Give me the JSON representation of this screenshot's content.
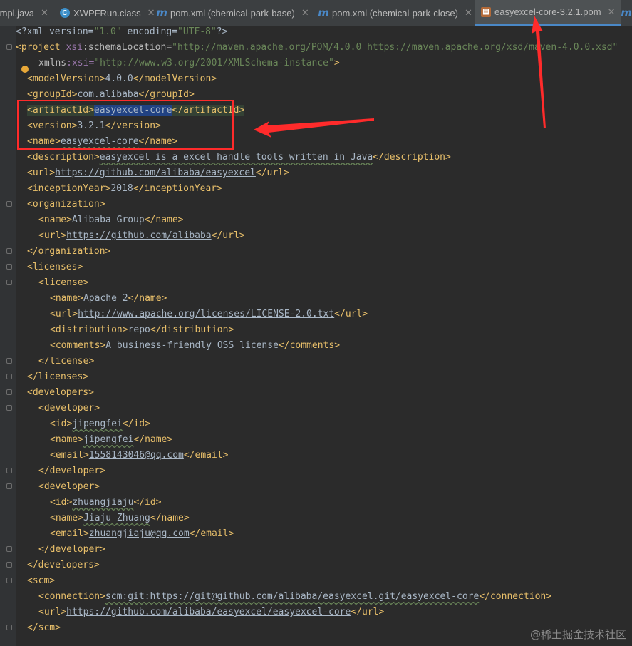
{
  "tabs": [
    {
      "label": "Impl.java",
      "icon": "java-file-icon",
      "active": false
    },
    {
      "label": "XWPFRun.class",
      "icon": "class-file-icon",
      "active": false
    },
    {
      "label": "pom.xml (chemical-park-base)",
      "icon": "maven-icon",
      "active": false
    },
    {
      "label": "pom.xml (chemical-park-close)",
      "icon": "maven-icon",
      "active": false
    },
    {
      "label": "easyexcel-core-3.2.1.pom",
      "icon": "pom-file-icon",
      "active": true
    }
  ],
  "code": {
    "l1": {
      "a": "<?xml version=",
      "b": "\"1.0\"",
      "c": " encoding=",
      "d": "\"UTF-8\"",
      "e": "?>"
    },
    "l2": {
      "a": "<project ",
      "b": "xsi",
      "c": ":schemaLocation=",
      "d": "\"http://maven.apache.org/POM/4.0.0 https://maven.apache.org/xsd/maven-4.0.0.xsd\""
    },
    "l3": {
      "a": "xmlns",
      "b": ":xsi=",
      "c": "\"http://www.w3.org/2001/XMLSchema-instance\"",
      "d": ">"
    },
    "l4": {
      "a": "<modelVersion>",
      "b": "4.0.0",
      "c": "</modelVersion>"
    },
    "l5": {
      "a": "<groupId>",
      "b": "com.alibaba",
      "c": "</groupId>"
    },
    "l6": {
      "a": "<artifactId>",
      "b": "easyexcel-core",
      "c": "</artifactId>"
    },
    "l7": {
      "a": "<version>",
      "b": "3.2.1",
      "c": "</version>"
    },
    "l8": {
      "a": "<name>",
      "b": "easyexcel-core",
      "c": "</name>"
    },
    "l9": {
      "a": "<description>",
      "b": "easyexcel is a excel handle tools written in Java",
      "c": "</description>"
    },
    "l10": {
      "a": "<url>",
      "b": "https://github.com/alibaba/easyexcel",
      "c": "</url>"
    },
    "l11": {
      "a": "<inceptionYear>",
      "b": "2018",
      "c": "</inceptionYear>"
    },
    "l12": {
      "a": "<organization>"
    },
    "l13": {
      "a": "<name>",
      "b": "Alibaba Group",
      "c": "</name>"
    },
    "l14": {
      "a": "<url>",
      "b": "https://github.com/alibaba",
      "c": "</url>"
    },
    "l15": {
      "a": "</organization>"
    },
    "l16": {
      "a": "<licenses>"
    },
    "l17": {
      "a": "<license>"
    },
    "l18": {
      "a": "<name>",
      "b": "Apache 2",
      "c": "</name>"
    },
    "l19": {
      "a": "<url>",
      "b": "http://www.apache.org/licenses/LICENSE-2.0.txt",
      "c": "</url>"
    },
    "l20": {
      "a": "<distribution>",
      "b": "repo",
      "c": "</distribution>"
    },
    "l21": {
      "a": "<comments>",
      "b": "A business-friendly OSS license",
      "c": "</comments>"
    },
    "l22": {
      "a": "</license>"
    },
    "l23": {
      "a": "</licenses>"
    },
    "l24": {
      "a": "<developers>"
    },
    "l25": {
      "a": "<developer>"
    },
    "l26": {
      "a": "<id>",
      "b": "jipengfei",
      "c": "</id>"
    },
    "l27": {
      "a": "<name>",
      "b": "jipengfei",
      "c": "</name>"
    },
    "l28": {
      "a": "<email>",
      "b": "1558143046@qq.com",
      "c": "</email>"
    },
    "l29": {
      "a": "</developer>"
    },
    "l30": {
      "a": "<developer>"
    },
    "l31": {
      "a": "<id>",
      "b": "zhuangjiaju",
      "c": "</id>"
    },
    "l32": {
      "a": "<name>",
      "b": "Jiaju Zhuang",
      "c": "</name>"
    },
    "l33": {
      "a": "<email>",
      "b": "zhuangjiaju@qq.com",
      "c": "</email>"
    },
    "l34": {
      "a": "</developer>"
    },
    "l35": {
      "a": "</developers>"
    },
    "l36": {
      "a": "<scm>"
    },
    "l37": {
      "a": "<connection>",
      "b": "scm:git:https://git@github.com/alibaba/easyexcel.git/easyexcel-core",
      "c": "</connection>"
    },
    "l38": {
      "a": "<url>",
      "b": "https://github.com/alibaba/easyexcel/easyexcel-core",
      "c": "</url>"
    },
    "l39": {
      "a": "</scm>"
    }
  },
  "watermark": "@稀土掘金技术社区",
  "colors": {
    "tag": "#e8bf6a",
    "text": "#a9b7c6",
    "string": "#6a8759",
    "namespace": "#9876aa",
    "annotation": "#ff2b2b"
  }
}
